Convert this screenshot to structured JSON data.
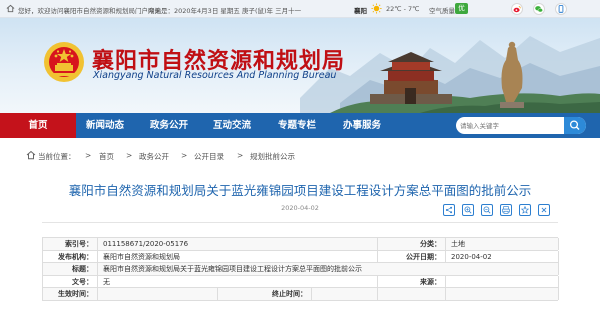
{
  "topbar": {
    "welcome": "您好，欢迎访问襄阳市自然资源和规划局门户网站",
    "date": "今天是：2020年4月3日 星期五 庚子(鼠)年 三月十一",
    "city": "襄阳",
    "temperature": "22℃ - 7℃",
    "air_quality_label": "空气质量：",
    "air_quality_value": "优",
    "social_icons": [
      "weibo-icon",
      "wechat-icon",
      "mobile-icon"
    ]
  },
  "banner": {
    "title_cn": "襄阳市自然资源和规划局",
    "title_en": "Xiangyang Natural Resources And Planning Bureau"
  },
  "nav": {
    "items": [
      {
        "label": "首页",
        "active": true
      },
      {
        "label": "新闻动态"
      },
      {
        "label": "政务公开"
      },
      {
        "label": "互动交流"
      },
      {
        "label": "专题专栏"
      },
      {
        "label": "办事服务"
      }
    ],
    "search_placeholder": "请输入关键字"
  },
  "breadcrumb": {
    "prefix": "当前位置：",
    "items": [
      "首页",
      "政务公开",
      "公开目录",
      "规划批前公示"
    ],
    "separator": ">"
  },
  "article": {
    "title": "襄阳市自然资源和规划局关于蓝光雍锦园项目建设工程设计方案总平面图的批前公示",
    "date": "2020-04-02",
    "share_icons": [
      "share-icon",
      "zoom-in-icon",
      "zoom-out-icon",
      "print-icon",
      "star-icon",
      "close-icon"
    ]
  },
  "info_table": {
    "index_label": "索引号：",
    "index_value": "011158671/2020-05176",
    "category_label": "分类：",
    "category_value": "土地",
    "issuer_label": "发布机构：",
    "issuer_value": "襄阳市自然资源和规划局",
    "pubdate_label": "公开日期：",
    "pubdate_value": "2020-04-02",
    "title_label": "标题：",
    "title_value": "襄阳市自然资源和规划局关于蓝光雍锦园项目建设工程设计方案总平面图的批前公示",
    "docno_label": "文号：",
    "docno_value": "无",
    "source_label": "来源：",
    "source_value": "",
    "effective_label": "生效时间：",
    "effective_value": "",
    "expiry_label": "终止时间：",
    "expiry_value": ""
  },
  "colors": {
    "nav_blue": "#1f65ae",
    "home_red": "#c4121b",
    "title_red": "#c00f14",
    "headline_blue": "#1f65ae"
  }
}
